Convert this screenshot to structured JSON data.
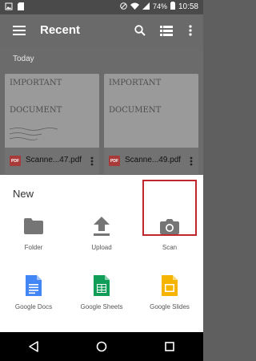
{
  "status_bar": {
    "battery": "74%",
    "time": "10:58"
  },
  "app_bar": {
    "title": "Recent"
  },
  "recent": {
    "section_label": "Today",
    "files": [
      {
        "name": "Scanne...47.pdf",
        "line1": "IMPORTANT",
        "line2": "DOCUMENT",
        "icon": "pdf-icon",
        "icon_text": "PDF"
      },
      {
        "name": "Scanne...49.pdf",
        "line1": "IMPORTANT",
        "line2": "DOCUMENT",
        "icon": "pdf-icon",
        "icon_text": "PDF"
      }
    ]
  },
  "new_sheet": {
    "title": "New",
    "actions": [
      {
        "label": "Folder",
        "icon": "folder-icon"
      },
      {
        "label": "Upload",
        "icon": "upload-icon"
      },
      {
        "label": "Scan",
        "icon": "camera-icon"
      },
      {
        "label": "Google Docs",
        "icon": "google-docs-icon"
      },
      {
        "label": "Google Sheets",
        "icon": "google-sheets-icon"
      },
      {
        "label": "Google Slides",
        "icon": "google-slides-icon"
      }
    ],
    "highlight_color": "#c0272d"
  },
  "colors": {
    "docs": "#4285f4",
    "sheets": "#0f9d58",
    "slides": "#f4b400",
    "pdf": "#a93a3a"
  }
}
